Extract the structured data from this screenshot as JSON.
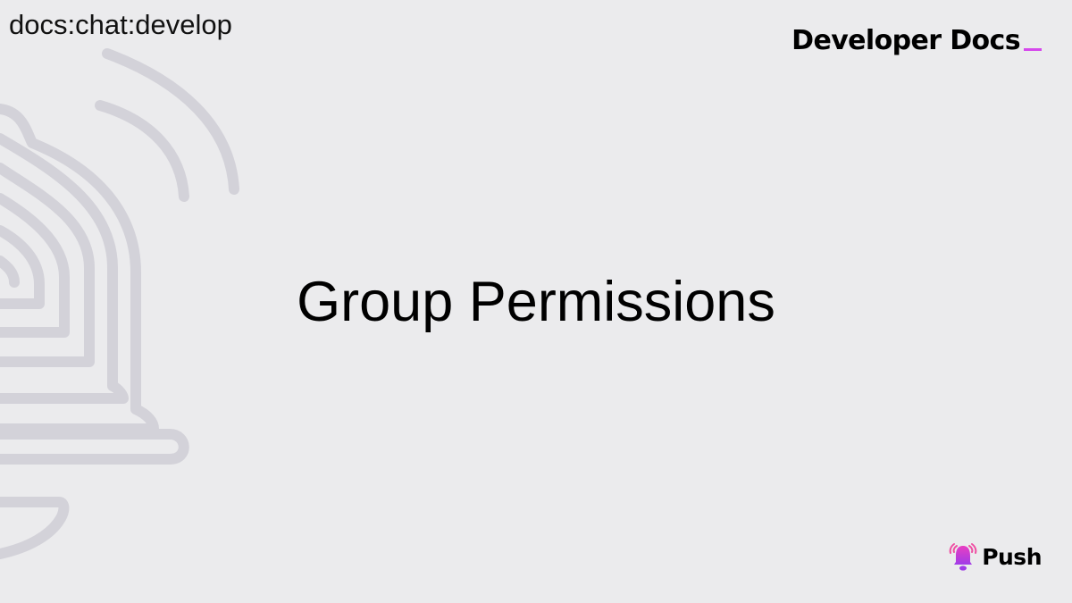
{
  "tag": "docs:chat:develop",
  "header": {
    "brand_title": "Developer Docs",
    "cursor_color": "#d548ec"
  },
  "main": {
    "title": "Group Permissions"
  },
  "footer": {
    "logo_text": "Push",
    "logo_icon": "bell-icon"
  },
  "background": {
    "color": "#ebebed",
    "watermark": "bell-outline-icon",
    "watermark_color": "#d3d2d9"
  }
}
